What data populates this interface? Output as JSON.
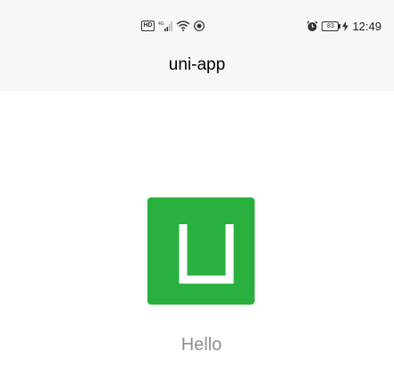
{
  "status_bar": {
    "left_icons": [
      "hd-icon",
      "signal-icon",
      "wifi-icon",
      "vpn-icon"
    ],
    "hd_label": "HD",
    "signal_label": "4G",
    "battery_level": "83",
    "time": "12:49",
    "right_icons": [
      "alarm-icon",
      "battery-icon",
      "charge-icon"
    ]
  },
  "nav": {
    "title": "uni-app"
  },
  "logo": {
    "name": "uni-app-logo",
    "color": "#2ab03f"
  },
  "content": {
    "greeting": "Hello"
  }
}
